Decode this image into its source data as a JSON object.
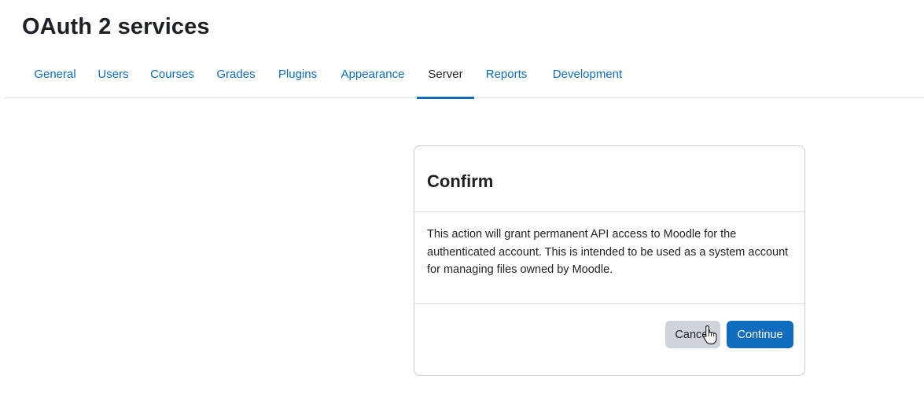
{
  "page": {
    "title": "OAuth 2 services"
  },
  "nav": {
    "tabs": [
      {
        "label": "General",
        "active": false
      },
      {
        "label": "Users",
        "active": false
      },
      {
        "label": "Courses",
        "active": false
      },
      {
        "label": "Grades",
        "active": false
      },
      {
        "label": "Plugins",
        "active": false
      },
      {
        "label": "Appearance",
        "active": false
      },
      {
        "label": "Server",
        "active": true
      },
      {
        "label": "Reports",
        "active": false
      },
      {
        "label": "Development",
        "active": false
      }
    ]
  },
  "modal": {
    "title": "Confirm",
    "body": "This action will grant permanent API access to Moodle for the authenticated account. This is intended to be used as a system account for managing files owned by Moodle.",
    "cancel_label": "Cancel",
    "continue_label": "Continue"
  },
  "colors": {
    "accent": "#0f6cbf",
    "text": "#1d2125",
    "secondary_button": "#ced4da",
    "border": "#dee2e6"
  },
  "icons": {
    "cursor": "hand-pointer-icon"
  }
}
